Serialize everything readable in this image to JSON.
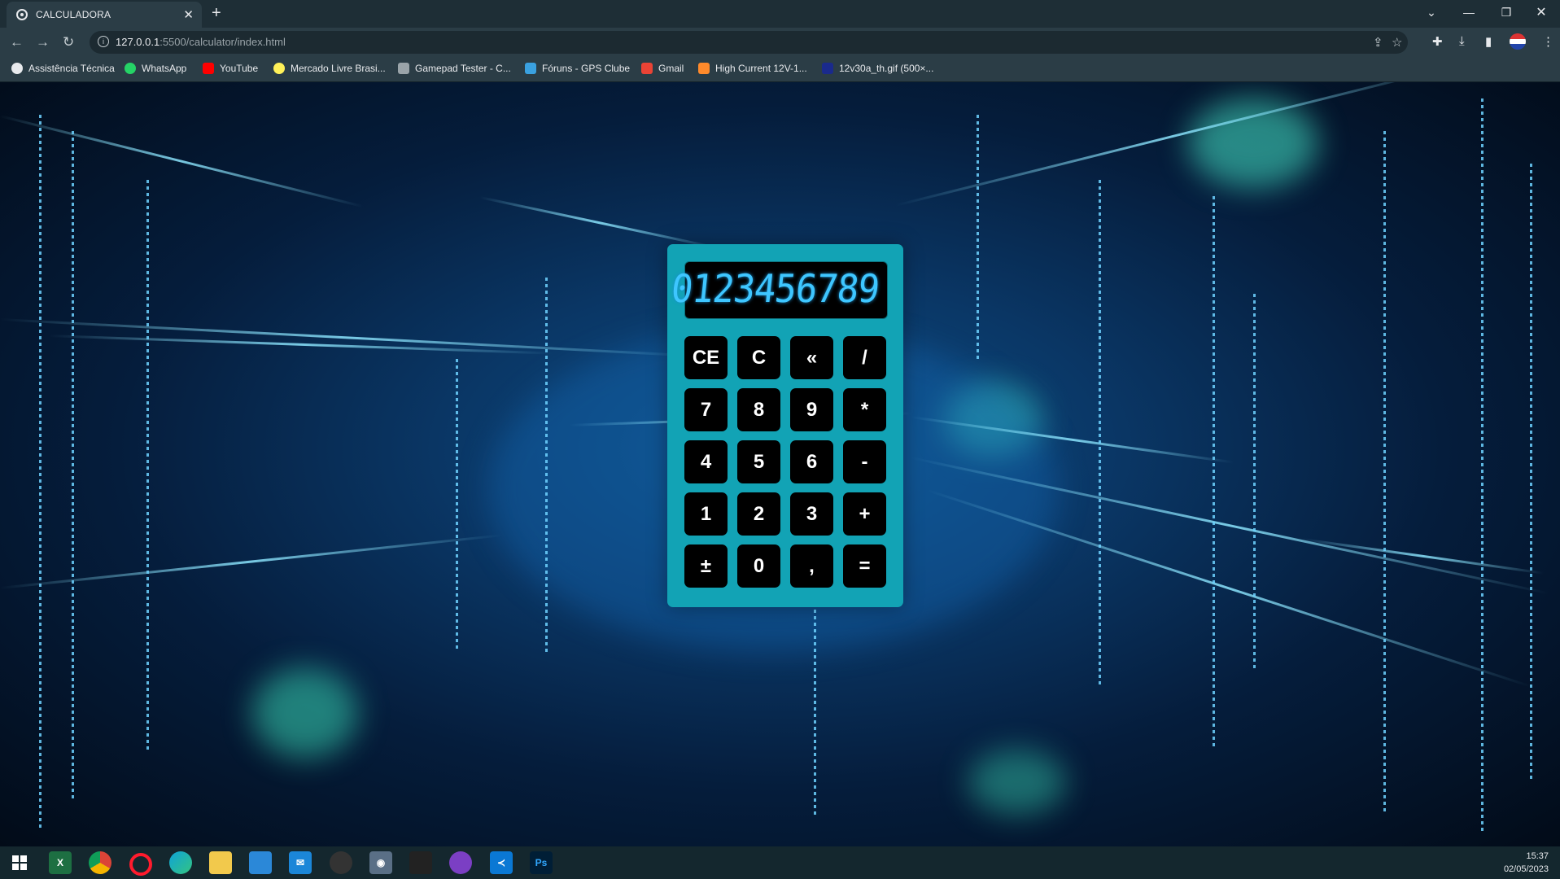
{
  "browser": {
    "tab_title": "CALCULADORA",
    "url_host": "127.0.0.1",
    "url_rest": ":5500/calculator/index.html",
    "bookmarks": [
      {
        "label": "Assistência Técnica",
        "icon": "globe-icon",
        "color": "#e8eaed"
      },
      {
        "label": "WhatsApp",
        "icon": "whatsapp-icon",
        "color": "#25d366"
      },
      {
        "label": "YouTube",
        "icon": "youtube-icon",
        "color": "#ff0000"
      },
      {
        "label": "Mercado Livre Brasi...",
        "icon": "mercadolivre-icon",
        "color": "#fff159"
      },
      {
        "label": "Gamepad Tester - C...",
        "icon": "gamepad-icon",
        "color": "#e8eaed"
      },
      {
        "label": "Fóruns - GPS Clube",
        "icon": "gps-icon",
        "color": "#3aa1e0"
      },
      {
        "label": "Gmail",
        "icon": "gmail-icon",
        "color": "#ea4335"
      },
      {
        "label": "High Current 12V-1...",
        "icon": "bookmark-icon",
        "color": "#ff8a2b"
      },
      {
        "label": "12v30a_th.gif (500×...",
        "icon": "image-icon",
        "color": "#1a2a8c"
      }
    ]
  },
  "calculator": {
    "display": "0123456789",
    "keys": [
      [
        "CE",
        "C",
        "«",
        "/"
      ],
      [
        "7",
        "8",
        "9",
        "*"
      ],
      [
        "4",
        "5",
        "6",
        "-"
      ],
      [
        "1",
        "2",
        "3",
        "+"
      ],
      [
        "±",
        "0",
        ",",
        "="
      ]
    ],
    "colors": {
      "body": "#12a3b5",
      "key": "#000000",
      "display_text": "#3ec6ff"
    }
  },
  "taskbar": {
    "apps": [
      "windows-start-icon",
      "excel-icon",
      "chrome-icon",
      "opera-icon",
      "edge-icon",
      "file-explorer-icon",
      "store-icon",
      "mail-icon",
      "obs-icon",
      "camera-icon",
      "app-icon",
      "github-icon",
      "vscode-icon",
      "photoshop-icon"
    ],
    "time": "15:37",
    "date": "02/05/2023"
  }
}
